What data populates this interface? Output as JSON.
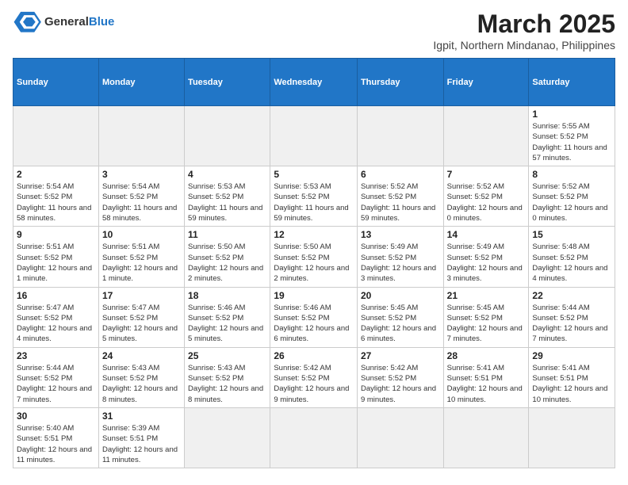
{
  "header": {
    "logo_general": "General",
    "logo_blue": "Blue",
    "title": "March 2025",
    "subtitle": "Igpit, Northern Mindanao, Philippines"
  },
  "weekdays": [
    "Sunday",
    "Monday",
    "Tuesday",
    "Wednesday",
    "Thursday",
    "Friday",
    "Saturday"
  ],
  "weeks": [
    [
      {
        "day": "",
        "info": ""
      },
      {
        "day": "",
        "info": ""
      },
      {
        "day": "",
        "info": ""
      },
      {
        "day": "",
        "info": ""
      },
      {
        "day": "",
        "info": ""
      },
      {
        "day": "",
        "info": ""
      },
      {
        "day": "1",
        "info": "Sunrise: 5:55 AM\nSunset: 5:52 PM\nDaylight: 11 hours\nand 57 minutes."
      }
    ],
    [
      {
        "day": "2",
        "info": "Sunrise: 5:54 AM\nSunset: 5:52 PM\nDaylight: 11 hours\nand 58 minutes."
      },
      {
        "day": "3",
        "info": "Sunrise: 5:54 AM\nSunset: 5:52 PM\nDaylight: 11 hours\nand 58 minutes."
      },
      {
        "day": "4",
        "info": "Sunrise: 5:53 AM\nSunset: 5:52 PM\nDaylight: 11 hours\nand 59 minutes."
      },
      {
        "day": "5",
        "info": "Sunrise: 5:53 AM\nSunset: 5:52 PM\nDaylight: 11 hours\nand 59 minutes."
      },
      {
        "day": "6",
        "info": "Sunrise: 5:52 AM\nSunset: 5:52 PM\nDaylight: 11 hours\nand 59 minutes."
      },
      {
        "day": "7",
        "info": "Sunrise: 5:52 AM\nSunset: 5:52 PM\nDaylight: 12 hours\nand 0 minutes."
      },
      {
        "day": "8",
        "info": "Sunrise: 5:52 AM\nSunset: 5:52 PM\nDaylight: 12 hours\nand 0 minutes."
      }
    ],
    [
      {
        "day": "9",
        "info": "Sunrise: 5:51 AM\nSunset: 5:52 PM\nDaylight: 12 hours\nand 1 minute."
      },
      {
        "day": "10",
        "info": "Sunrise: 5:51 AM\nSunset: 5:52 PM\nDaylight: 12 hours\nand 1 minute."
      },
      {
        "day": "11",
        "info": "Sunrise: 5:50 AM\nSunset: 5:52 PM\nDaylight: 12 hours\nand 2 minutes."
      },
      {
        "day": "12",
        "info": "Sunrise: 5:50 AM\nSunset: 5:52 PM\nDaylight: 12 hours\nand 2 minutes."
      },
      {
        "day": "13",
        "info": "Sunrise: 5:49 AM\nSunset: 5:52 PM\nDaylight: 12 hours\nand 3 minutes."
      },
      {
        "day": "14",
        "info": "Sunrise: 5:49 AM\nSunset: 5:52 PM\nDaylight: 12 hours\nand 3 minutes."
      },
      {
        "day": "15",
        "info": "Sunrise: 5:48 AM\nSunset: 5:52 PM\nDaylight: 12 hours\nand 4 minutes."
      }
    ],
    [
      {
        "day": "16",
        "info": "Sunrise: 5:47 AM\nSunset: 5:52 PM\nDaylight: 12 hours\nand 4 minutes."
      },
      {
        "day": "17",
        "info": "Sunrise: 5:47 AM\nSunset: 5:52 PM\nDaylight: 12 hours\nand 5 minutes."
      },
      {
        "day": "18",
        "info": "Sunrise: 5:46 AM\nSunset: 5:52 PM\nDaylight: 12 hours\nand 5 minutes."
      },
      {
        "day": "19",
        "info": "Sunrise: 5:46 AM\nSunset: 5:52 PM\nDaylight: 12 hours\nand 6 minutes."
      },
      {
        "day": "20",
        "info": "Sunrise: 5:45 AM\nSunset: 5:52 PM\nDaylight: 12 hours\nand 6 minutes."
      },
      {
        "day": "21",
        "info": "Sunrise: 5:45 AM\nSunset: 5:52 PM\nDaylight: 12 hours\nand 7 minutes."
      },
      {
        "day": "22",
        "info": "Sunrise: 5:44 AM\nSunset: 5:52 PM\nDaylight: 12 hours\nand 7 minutes."
      }
    ],
    [
      {
        "day": "23",
        "info": "Sunrise: 5:44 AM\nSunset: 5:52 PM\nDaylight: 12 hours\nand 7 minutes."
      },
      {
        "day": "24",
        "info": "Sunrise: 5:43 AM\nSunset: 5:52 PM\nDaylight: 12 hours\nand 8 minutes."
      },
      {
        "day": "25",
        "info": "Sunrise: 5:43 AM\nSunset: 5:52 PM\nDaylight: 12 hours\nand 8 minutes."
      },
      {
        "day": "26",
        "info": "Sunrise: 5:42 AM\nSunset: 5:52 PM\nDaylight: 12 hours\nand 9 minutes."
      },
      {
        "day": "27",
        "info": "Sunrise: 5:42 AM\nSunset: 5:52 PM\nDaylight: 12 hours\nand 9 minutes."
      },
      {
        "day": "28",
        "info": "Sunrise: 5:41 AM\nSunset: 5:51 PM\nDaylight: 12 hours\nand 10 minutes."
      },
      {
        "day": "29",
        "info": "Sunrise: 5:41 AM\nSunset: 5:51 PM\nDaylight: 12 hours\nand 10 minutes."
      }
    ],
    [
      {
        "day": "30",
        "info": "Sunrise: 5:40 AM\nSunset: 5:51 PM\nDaylight: 12 hours\nand 11 minutes."
      },
      {
        "day": "31",
        "info": "Sunrise: 5:39 AM\nSunset: 5:51 PM\nDaylight: 12 hours\nand 11 minutes."
      },
      {
        "day": "",
        "info": ""
      },
      {
        "day": "",
        "info": ""
      },
      {
        "day": "",
        "info": ""
      },
      {
        "day": "",
        "info": ""
      },
      {
        "day": "",
        "info": ""
      }
    ]
  ]
}
